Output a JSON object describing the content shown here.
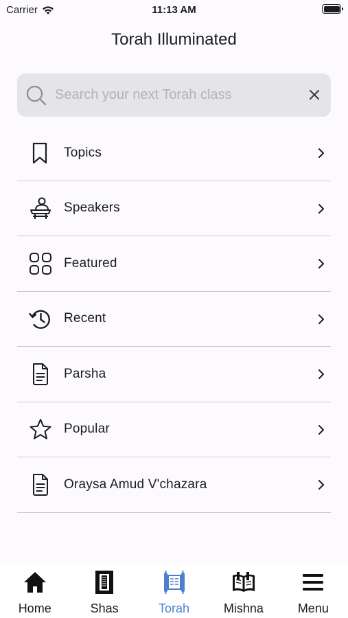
{
  "status_bar": {
    "carrier": "Carrier",
    "time": "11:13 AM"
  },
  "header": {
    "title": "Torah Illuminated"
  },
  "search": {
    "placeholder": "Search your next Torah class",
    "value": ""
  },
  "menu": {
    "items": [
      {
        "label": "Topics",
        "icon": "bookmark-icon"
      },
      {
        "label": "Speakers",
        "icon": "speaker-icon"
      },
      {
        "label": "Featured",
        "icon": "grid-icon"
      },
      {
        "label": "Recent",
        "icon": "history-icon"
      },
      {
        "label": "Parsha",
        "icon": "document-icon"
      },
      {
        "label": "Popular",
        "icon": "star-icon"
      },
      {
        "label": "Oraysa Amud V'chazara",
        "icon": "document-icon"
      }
    ]
  },
  "tab_bar": {
    "active": "Torah",
    "active_color": "#4a80cf",
    "tabs": [
      {
        "label": "Home",
        "icon": "home-icon"
      },
      {
        "label": "Shas",
        "icon": "shas-icon"
      },
      {
        "label": "Torah",
        "icon": "torah-scroll-icon"
      },
      {
        "label": "Mishna",
        "icon": "book-icon"
      },
      {
        "label": "Menu",
        "icon": "hamburger-icon"
      }
    ]
  }
}
